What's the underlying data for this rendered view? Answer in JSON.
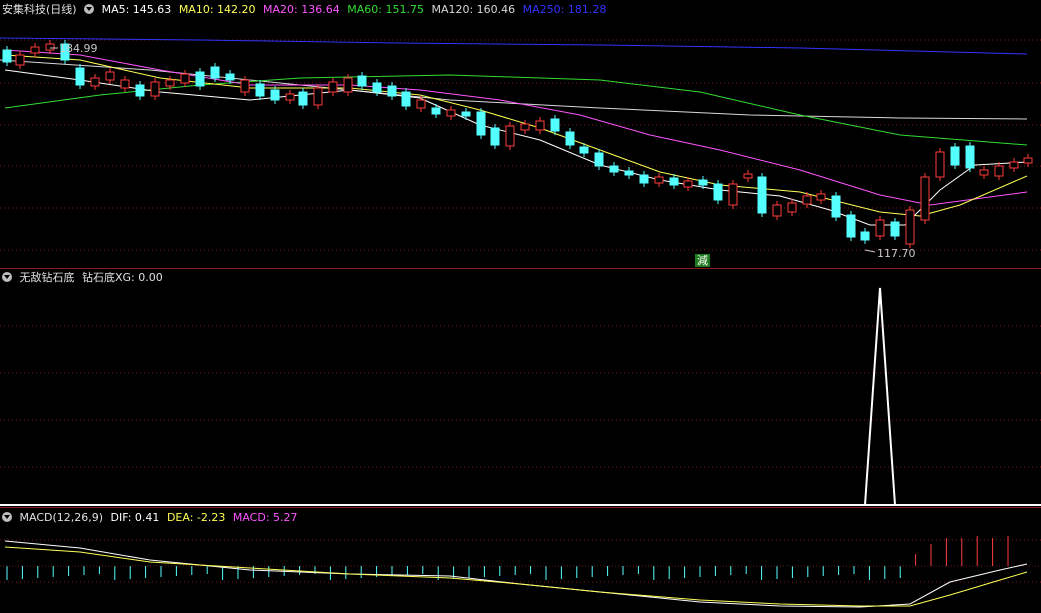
{
  "main": {
    "title": "安集科技(日线)",
    "ma": [
      {
        "label": "MA5: 145.63",
        "color": "#ffffff"
      },
      {
        "label": "MA10: 142.20",
        "color": "#ffff55"
      },
      {
        "label": "MA20: 136.64",
        "color": "#ff55ff"
      },
      {
        "label": "MA60: 151.75",
        "color": "#33dd33"
      },
      {
        "label": "MA120: 160.46",
        "color": "#d8d8d8"
      },
      {
        "label": "MA250: 181.28",
        "color": "#3333ff"
      }
    ],
    "high_label": "184.99",
    "low_label": "117.70",
    "signal_label": "減"
  },
  "indicator": {
    "title": "无敌钻石底",
    "xg_label": "钻石底XG: 0.00"
  },
  "macd": {
    "title": "MACD(12,26,9)",
    "dif": "DIF: 0.41",
    "dea": "DEA: -2.23",
    "macd": "MACD: 5.27"
  },
  "colors": {
    "up": "#ff3c3c",
    "down": "#54ffff",
    "separator": "#8b1a1a",
    "grid": "#7a1a1a"
  }
}
